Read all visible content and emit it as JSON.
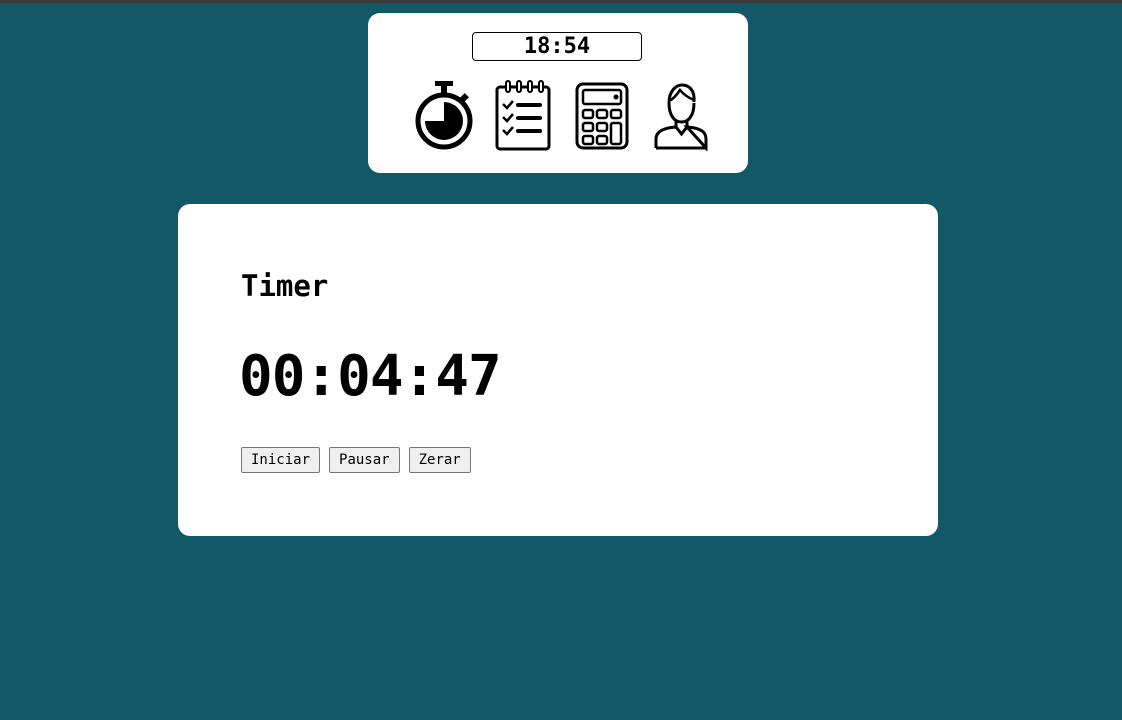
{
  "header": {
    "clock": "18:54",
    "nav_icons": [
      {
        "name": "stopwatch-icon",
        "label": "Timer"
      },
      {
        "name": "checklist-icon",
        "label": "Tarefas"
      },
      {
        "name": "calculator-icon",
        "label": "Calculadora"
      },
      {
        "name": "user-icon",
        "label": "Perfil"
      }
    ]
  },
  "timer": {
    "title": "Timer",
    "display": "00:04:47",
    "buttons": {
      "start": "Iniciar",
      "pause": "Pausar",
      "reset": "Zerar"
    }
  },
  "colors": {
    "background": "#125866",
    "card": "#ffffff",
    "text": "#000000"
  }
}
